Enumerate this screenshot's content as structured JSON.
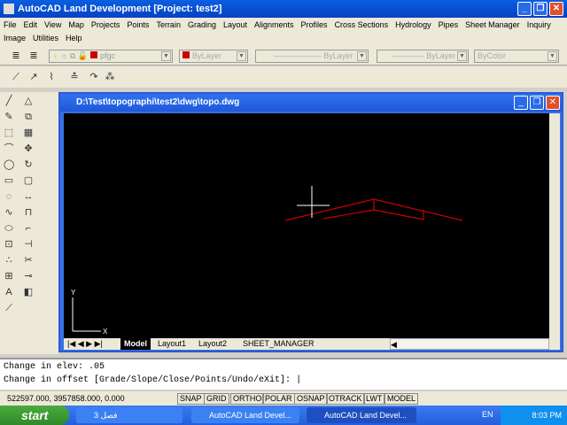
{
  "window": {
    "title": "AutoCAD Land Development [Project: test2]"
  },
  "menu": [
    "File",
    "Edit",
    "View",
    "Map",
    "Projects",
    "Points",
    "Terrain",
    "Grading",
    "Layout",
    "Alignments",
    "Profiles",
    "Cross Sections",
    "Hydrology",
    "Pipes",
    "Sheet Manager",
    "Inquiry",
    "Image",
    "Utilities",
    "Help"
  ],
  "properties": {
    "layer": "pfgc",
    "color": "ByLayer",
    "linetype": "ByLayer",
    "lineweight": "ByLayer",
    "plotstyle": "ByColor",
    "layer_color": "#cc0000"
  },
  "document": {
    "title": "D:\\Test\\topographi\\test2\\dwg\\topo.dwg",
    "ucs_x": "X",
    "ucs_y": "Y"
  },
  "tabs": [
    "Model",
    "Layout1",
    "Layout2",
    "SHEET_MANAGER"
  ],
  "command": {
    "line1": "Change in elev: .05",
    "line2": "Change in offset [Grade/Slope/Close/Points/Undo/eXit]:"
  },
  "status": {
    "coords": "522597.000, 3957858.000, 0.000",
    "toggles": [
      "SNAP",
      "GRID",
      "ORTHO",
      "POLAR",
      "OSNAP",
      "OTRACK",
      "LWT",
      "MODEL"
    ]
  },
  "taskbar": {
    "start": "start",
    "items": [
      "فصل 3",
      "AutoCAD Land Devel...",
      "AutoCAD Land Devel..."
    ],
    "lang": "EN",
    "time": "8:03 PM"
  },
  "drawing": {
    "line_color": "#cc0000"
  }
}
